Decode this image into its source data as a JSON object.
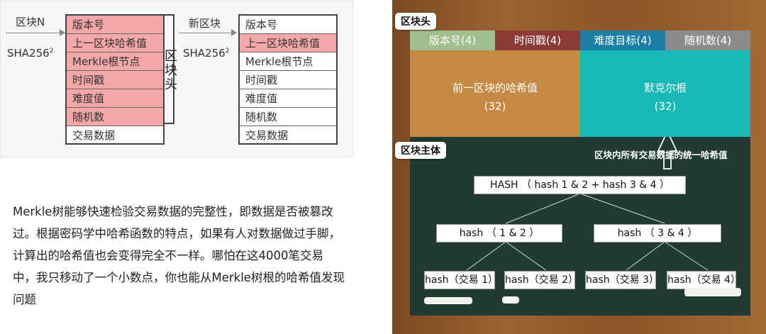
{
  "left_diagram": {
    "block_n_label": "区块N",
    "new_block_label": "新区块",
    "sha_label": "SHA256",
    "sha_sup": "2",
    "header_label": "区块头",
    "block_n_fields": [
      "版本号",
      "上一区块哈希值",
      "Merkle根节点",
      "时间戳",
      "难度值",
      "随机数",
      "交易数据"
    ],
    "new_block_fields": [
      "版本号",
      "上一区块哈希值",
      "Merkle根节点",
      "时间戳",
      "难度值",
      "随机数",
      "交易数据"
    ],
    "colors": {
      "highlight": "#f4a7a7"
    }
  },
  "paragraph": "Merkle树能够快速检验交易数据的完整性，即数据是否被篡改过。根据密码学中哈希函数的特点，如果有人对数据做过手脚，计算出的哈希值也会变得完全不一样。哪怕在这4000笔交易中，我只移动了一个小数点，你也能从Merkle树根的哈希值发现问题",
  "board": {
    "header_tag": "区块头",
    "body_tag": "区块主体",
    "header_fields": [
      {
        "label": "版本号(4)",
        "color": "#9fbf8f"
      },
      {
        "label": "时间戳(4)",
        "color": "#8b3a36"
      },
      {
        "label": "难度目标(4)",
        "color": "#1b7fa6"
      },
      {
        "label": "随机数(4)",
        "color": "#8c8c8c"
      }
    ],
    "prev_hash": {
      "label": "前一区块的哈希值",
      "size": "(32)",
      "color": "#c78a45"
    },
    "merkle_root": {
      "label": "默克尔根",
      "size": "(32)",
      "color": "#17b8b5"
    },
    "body_caption": "区块内所有交易数据的统一哈希值",
    "tree": {
      "root": "HASH （ hash 1 & 2 + hash 3 & 4 ）",
      "level1": [
        "hash （ 1 & 2 ）",
        "hash （ 3 & 4 ）"
      ],
      "leaves": [
        "hash（交易 1）",
        "hash（交易 2）",
        "hash（交易 3）",
        "hash（交易 4）"
      ]
    }
  }
}
